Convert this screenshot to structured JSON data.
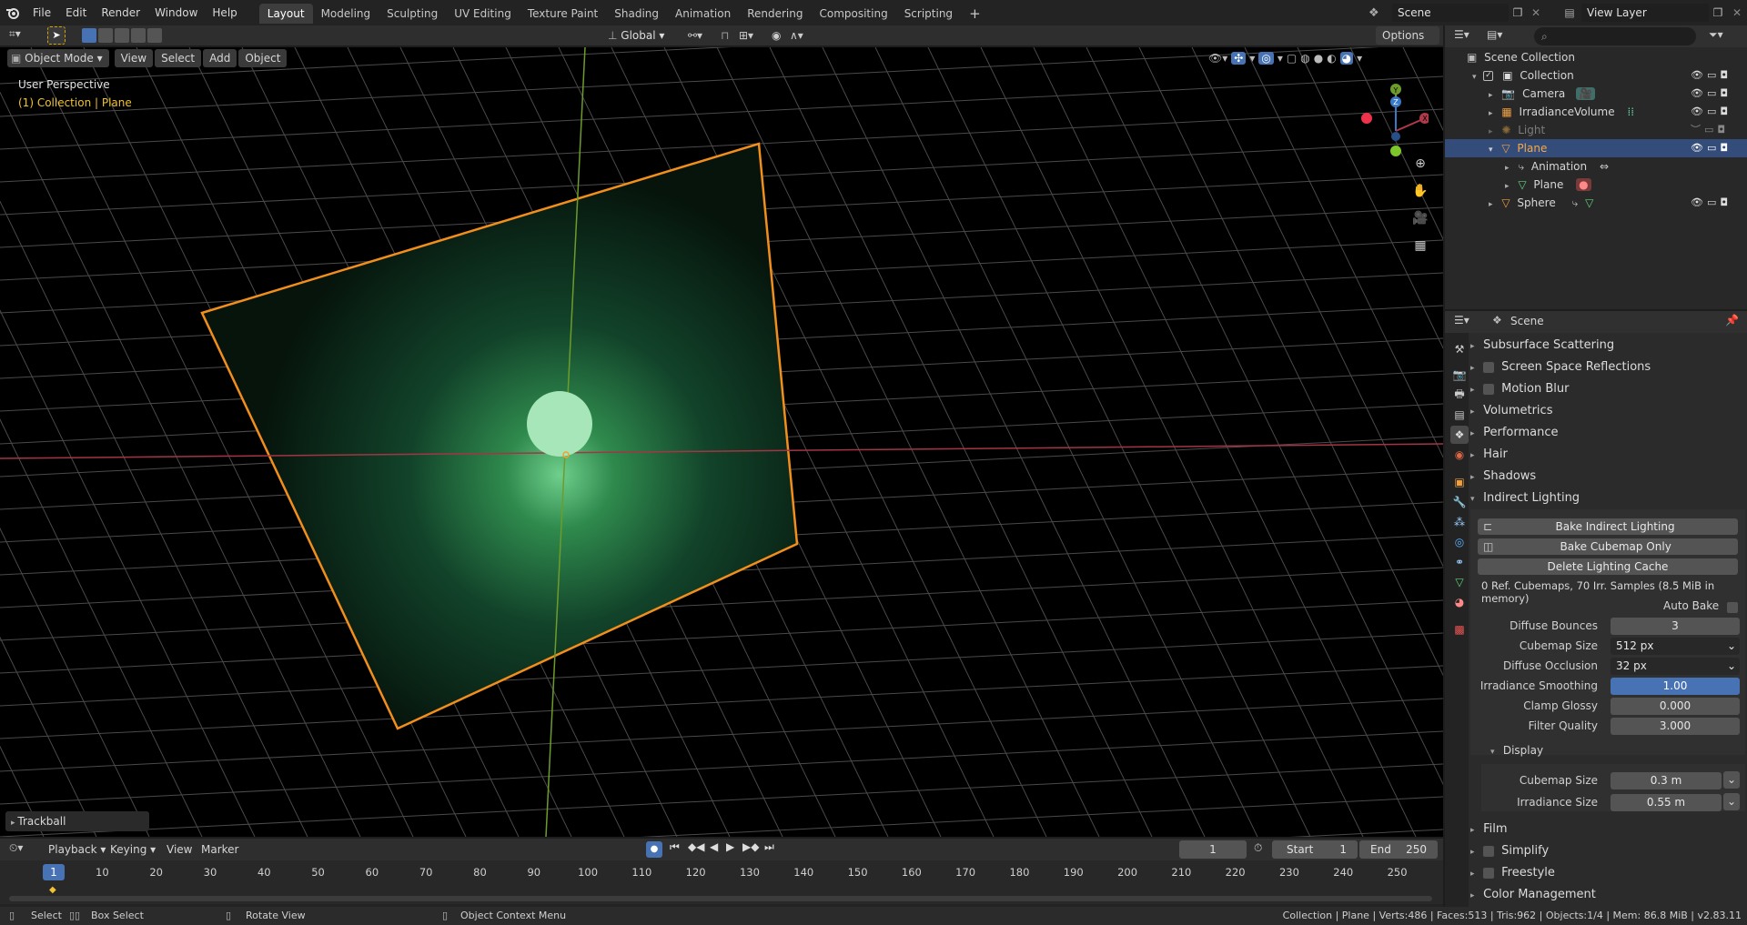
{
  "topbar": {
    "menus": [
      "File",
      "Edit",
      "Render",
      "Window",
      "Help"
    ],
    "workspaces": [
      "Layout",
      "Modeling",
      "Sculpting",
      "UV Editing",
      "Texture Paint",
      "Shading",
      "Animation",
      "Rendering",
      "Compositing",
      "Scripting"
    ],
    "active_workspace": "Layout",
    "add_tab": "+",
    "scene": "Scene",
    "view_layer": "View Layer"
  },
  "toolheader": {
    "orientation": "Global",
    "options": "Options"
  },
  "viewport_header": {
    "mode": "Object Mode",
    "menus": [
      "View",
      "Select",
      "Add",
      "Object"
    ]
  },
  "viewport": {
    "perspective": "User Perspective",
    "context": "(1) Collection | Plane",
    "last_op": "Trackball",
    "gizmo": {
      "x": "X",
      "y": "Y",
      "z": "Z"
    }
  },
  "outliner": {
    "root": "Scene Collection",
    "items": [
      {
        "label": "Collection"
      },
      {
        "label": "Camera"
      },
      {
        "label": "IrradianceVolume"
      },
      {
        "label": "Light"
      },
      {
        "label": "Plane"
      },
      {
        "label": "Animation"
      },
      {
        "label": "Plane"
      },
      {
        "label": "Sphere"
      }
    ]
  },
  "properties": {
    "context": "Scene",
    "panels_top": [
      "Subsurface Scattering",
      "Screen Space Reflections",
      "Motion Blur",
      "Volumetrics",
      "Performance",
      "Hair",
      "Shadows",
      "Indirect Lighting"
    ],
    "buttons": [
      "Bake Indirect Lighting",
      "Bake Cubemap Only",
      "Delete Lighting Cache"
    ],
    "info": "0 Ref. Cubemaps, 70 Irr. Samples (8.5 MiB in memory)",
    "auto_bake": "Auto Bake",
    "fields": [
      {
        "label": "Diffuse Bounces",
        "value": "3"
      },
      {
        "label": "Cubemap Size",
        "value": "512 px"
      },
      {
        "label": "Diffuse Occlusion",
        "value": "32 px"
      },
      {
        "label": "Irradiance Smoothing",
        "value": "1.00"
      },
      {
        "label": "Clamp Glossy",
        "value": "0.000"
      },
      {
        "label": "Filter Quality",
        "value": "3.000"
      }
    ],
    "display": "Display",
    "display_fields": [
      {
        "label": "Cubemap Size",
        "value": "0.3 m"
      },
      {
        "label": "Irradiance Size",
        "value": "0.55 m"
      }
    ],
    "panels_bottom": [
      "Film",
      "Simplify",
      "Freestyle",
      "Color Management"
    ]
  },
  "timeline": {
    "menus": [
      "Playback",
      "Keying",
      "View",
      "Marker"
    ],
    "current_frame": "1",
    "start_label": "Start",
    "start": "1",
    "end_label": "End",
    "end": "250",
    "ticks": [
      "1",
      "10",
      "20",
      "30",
      "40",
      "50",
      "60",
      "70",
      "80",
      "90",
      "100",
      "110",
      "120",
      "130",
      "140",
      "150",
      "160",
      "170",
      "180",
      "190",
      "200",
      "210",
      "220",
      "230",
      "240",
      "250"
    ]
  },
  "statusbar": {
    "select": "Select",
    "box_select": "Box Select",
    "rotate": "Rotate View",
    "context_menu": "Object Context Menu",
    "stats": "Collection | Plane | Verts:486 | Faces:513 | Tris:962 | Objects:1/4 | Mem: 86.8 MiB | v2.83.11"
  }
}
